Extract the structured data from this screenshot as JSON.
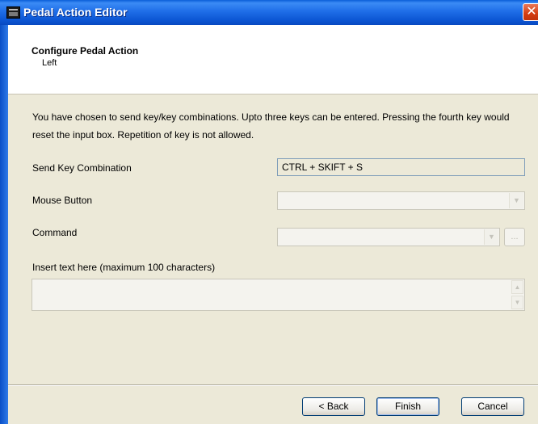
{
  "window": {
    "title": "Pedal Action Editor",
    "close_glyph": "✕"
  },
  "header": {
    "title": "Configure Pedal Action",
    "subtitle": "Left"
  },
  "instructions": "You have chosen to send key/key combinations. Upto three keys can be entered. Pressing the fourth key would reset the input box. Repetition of key is not allowed.",
  "form": {
    "send_key_label": "Send Key Combination",
    "send_key_value": "CTRL + SKIFT + S",
    "mouse_button_label": "Mouse Button",
    "mouse_button_value": "",
    "command_label": "Command",
    "command_value": "",
    "browse_label": "...",
    "insert_text_label": "Insert text here (maximum 100 characters)",
    "insert_text_value": ""
  },
  "buttons": {
    "back": "< Back",
    "finish": "Finish",
    "cancel": "Cancel"
  },
  "colors": {
    "titlebar": "#0c56d3",
    "dialog_bg": "#ece9d8",
    "close": "#d33d12"
  }
}
